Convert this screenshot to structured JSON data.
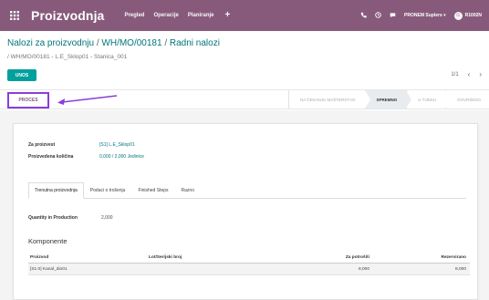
{
  "topbar": {
    "app_title": "Proizvodnja",
    "menu": [
      "Pregled",
      "Operacije",
      "Planiranje"
    ],
    "plus": "+",
    "company": "PRONEM Suplers",
    "user": "R1002N"
  },
  "breadcrumb": {
    "parts": [
      "Nalozi za proizvodnju",
      "WH/MO/00181",
      "Radni nalozi"
    ],
    "sep": " / "
  },
  "sub_breadcrumb": {
    "parts": [
      "/ WH/MO/00181",
      "L.E_Sklop01",
      "Stanica_001"
    ],
    "sep": " - "
  },
  "create_label": "UNOS",
  "pager": {
    "label": "1/1",
    "prev": "‹",
    "next": "›"
  },
  "proces_label": "PROCES",
  "stages": [
    {
      "label": "NA ČEKANJU MAŠTERSTVO",
      "active": false
    },
    {
      "label": "SPREMNO",
      "active": true
    },
    {
      "label": "U TIJEKU",
      "active": false
    },
    {
      "label": "DOVRŠENO",
      "active": false
    }
  ],
  "fields": {
    "product_label": "Za proizvest",
    "product_value": "[S1] L.E_Sklop01",
    "qty_label": "Proizvedena količina",
    "qty_value": "0,000 / 2,000 Jedinice"
  },
  "tabs": [
    "Trenutna proizvodnja",
    "Podaci o trošenju",
    "Finished Steps",
    "Razno"
  ],
  "current": {
    "label": "Quantity in Production",
    "value": "2,000"
  },
  "components": {
    "title": "Komponente",
    "headers": [
      "Proizvod",
      "Lot/Serijski broj",
      "Za potrošiti",
      "Rezervirano"
    ],
    "rows": [
      {
        "product": "[S1.0] Kanal_dio01",
        "lot": "",
        "to_consume": "8,000",
        "reserved": "8,000"
      }
    ]
  },
  "colors": {
    "brand": "#875a7b",
    "accent": "#00a09d",
    "link": "#00757a",
    "highlight": "#8a3ddb"
  }
}
